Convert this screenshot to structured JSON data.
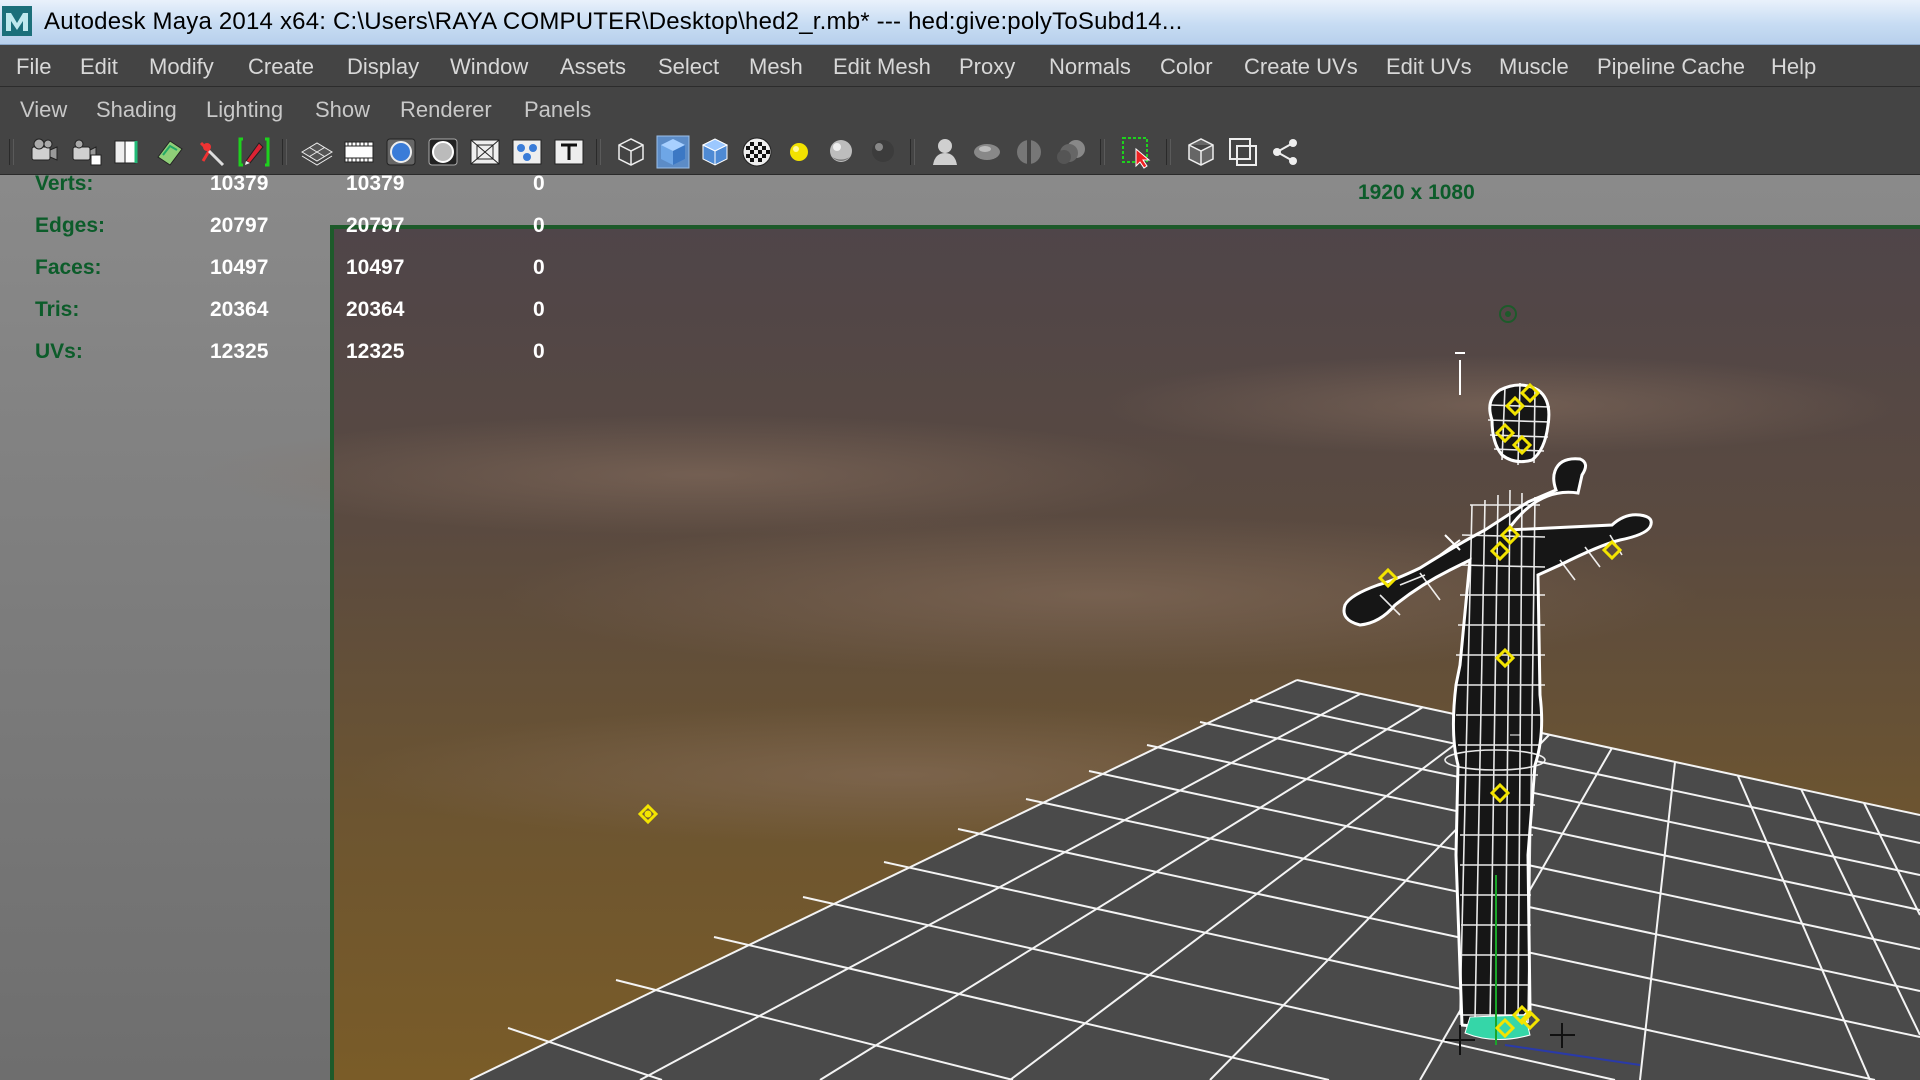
{
  "window": {
    "title": "Autodesk Maya 2014 x64: C:\\Users\\RAYA COMPUTER\\Desktop\\hed2_r.mb*   ---   hed:give:polyToSubd14..."
  },
  "menubar": [
    "File",
    "Edit",
    "Modify",
    "Create",
    "Display",
    "Window",
    "Assets",
    "Select",
    "Mesh",
    "Edit Mesh",
    "Proxy",
    "Normals",
    "Color",
    "Create UVs",
    "Edit UVs",
    "Muscle",
    "Pipeline Cache",
    "Help"
  ],
  "panel_menu": [
    "View",
    "Shading",
    "Lighting",
    "Show",
    "Renderer",
    "Panels"
  ],
  "toolbar_icons": [
    "select-camera-icon",
    "camera-attributes-icon",
    "bookmarks-icon",
    "image-plane-icon",
    "grease-pencil-icon",
    "isolate-select-icon",
    "grid-icon",
    "film-gate-icon",
    "resolution-gate-icon",
    "gate-mask-icon",
    "field-chart-icon",
    "safe-action-icon",
    "safe-title-icon",
    "wireframe-icon",
    "smooth-shade-icon",
    "wireframe-on-shaded-icon",
    "textured-icon",
    "use-default-light-icon",
    "shadows-icon",
    "screen-space-ao-icon",
    "xray-icon",
    "xray-active-icon",
    "xray-joints-icon",
    "motion-blur-icon",
    "highlight-selection-icon",
    "isolate-view-icon",
    "frame-selection-icon",
    "hypershade-icon"
  ],
  "hud": {
    "rows": [
      {
        "label": "Verts:",
        "obj": "10379",
        "sel": "10379",
        "uv": "0"
      },
      {
        "label": "Edges:",
        "obj": "20797",
        "sel": "20797",
        "uv": "0"
      },
      {
        "label": "Faces:",
        "obj": "10497",
        "sel": "10497",
        "uv": "0"
      },
      {
        "label": "Tris:",
        "obj": "20364",
        "sel": "20364",
        "uv": "0"
      },
      {
        "label": "UVs:",
        "obj": "12325",
        "sel": "12325",
        "uv": "0"
      }
    ],
    "resolution": "1920 x 1080"
  },
  "colors": {
    "hud_green": "#0c5c2a",
    "resolution_gate": "#1d5a2a",
    "grid": "#f4f4f4",
    "grid_floor": "#4a4a4a",
    "joint": "#f3e400"
  }
}
